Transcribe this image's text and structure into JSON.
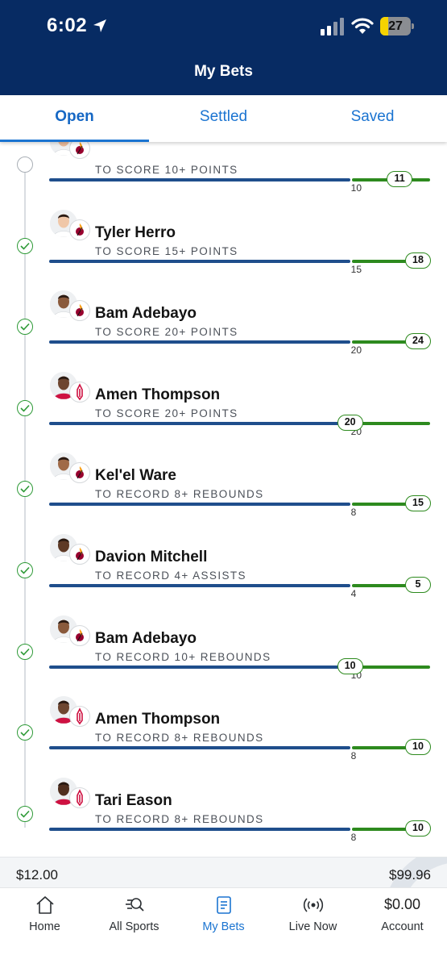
{
  "status_bar": {
    "time": "6:02",
    "battery": "27"
  },
  "header": {
    "title": "My Bets"
  },
  "tabs": [
    {
      "label": "Open",
      "active": true
    },
    {
      "label": "Settled",
      "active": false
    },
    {
      "label": "Saved",
      "active": false
    }
  ],
  "bets": [
    {
      "player": "",
      "team": "heat",
      "market": "TO SCORE 10+ POINTS",
      "target": "10",
      "current": "11",
      "settled": false,
      "target_fraction": 0.79,
      "current_fraction": 0.92
    },
    {
      "player": "Tyler Herro",
      "team": "heat",
      "market": "TO SCORE 15+ POINTS",
      "target": "15",
      "current": "18",
      "settled": true,
      "target_fraction": 0.79,
      "current_fraction": 0.98
    },
    {
      "player": "Bam Adebayo",
      "team": "heat",
      "market": "TO SCORE 20+ POINTS",
      "target": "20",
      "current": "24",
      "settled": true,
      "target_fraction": 0.79,
      "current_fraction": 0.98
    },
    {
      "player": "Amen Thompson",
      "team": "rockets",
      "market": "TO SCORE 20+ POINTS",
      "target": "20",
      "current": "20",
      "settled": true,
      "target_fraction": 0.79,
      "current_fraction": 0.79
    },
    {
      "player": "Kel'el Ware",
      "team": "heat",
      "market": "TO RECORD 8+ REBOUNDS",
      "target": "8",
      "current": "15",
      "settled": true,
      "target_fraction": 0.79,
      "current_fraction": 0.98
    },
    {
      "player": "Davion Mitchell",
      "team": "heat",
      "market": "TO RECORD 4+ ASSISTS",
      "target": "4",
      "current": "5",
      "settled": true,
      "target_fraction": 0.79,
      "current_fraction": 0.98
    },
    {
      "player": "Bam Adebayo",
      "team": "heat",
      "market": "TO RECORD 10+ REBOUNDS",
      "target": "10",
      "current": "10",
      "settled": true,
      "target_fraction": 0.79,
      "current_fraction": 0.79
    },
    {
      "player": "Amen Thompson",
      "team": "rockets",
      "market": "TO RECORD 8+ REBOUNDS",
      "target": "8",
      "current": "10",
      "settled": true,
      "target_fraction": 0.79,
      "current_fraction": 0.98
    },
    {
      "player": "Tari Eason",
      "team": "rockets",
      "market": "TO RECORD 8+ REBOUNDS",
      "target": "8",
      "current": "10",
      "settled": true,
      "target_fraction": 0.79,
      "current_fraction": 0.98
    }
  ],
  "summary": {
    "wager": "$12.00",
    "payout": "$99.96"
  },
  "nav": {
    "items": [
      {
        "label": "Home",
        "icon": "home-icon",
        "active": false
      },
      {
        "label": "All Sports",
        "icon": "search-icon",
        "active": false
      },
      {
        "label": "My Bets",
        "icon": "bet-slip-icon",
        "active": true
      },
      {
        "label": "Live Now",
        "icon": "live-broadcast-icon",
        "active": false
      },
      {
        "label": "Account",
        "icon": "account-balance",
        "active": false
      }
    ],
    "balance": "$0.00"
  },
  "colors": {
    "header_bg": "#072b63",
    "accent_blue": "#1b74d1",
    "progress_blue": "#1f4e8c",
    "progress_green": "#2d8a1e",
    "heat_red": "#98002e",
    "rockets_red": "#ce1141"
  }
}
